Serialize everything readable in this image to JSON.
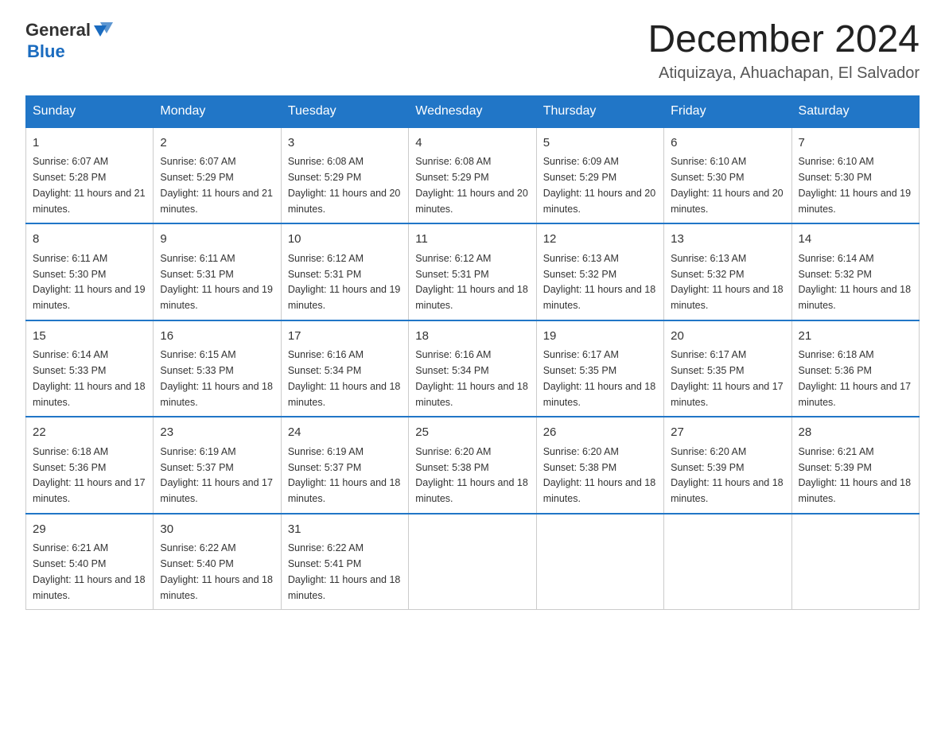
{
  "logo": {
    "text_general": "General",
    "text_blue": "Blue",
    "arrow_color": "#1a6bbf"
  },
  "header": {
    "title": "December 2024",
    "subtitle": "Atiquizaya, Ahuachapan, El Salvador"
  },
  "days_of_week": [
    "Sunday",
    "Monday",
    "Tuesday",
    "Wednesday",
    "Thursday",
    "Friday",
    "Saturday"
  ],
  "weeks": [
    [
      {
        "day": "1",
        "sunrise": "6:07 AM",
        "sunset": "5:28 PM",
        "daylight": "11 hours and 21 minutes."
      },
      {
        "day": "2",
        "sunrise": "6:07 AM",
        "sunset": "5:29 PM",
        "daylight": "11 hours and 21 minutes."
      },
      {
        "day": "3",
        "sunrise": "6:08 AM",
        "sunset": "5:29 PM",
        "daylight": "11 hours and 20 minutes."
      },
      {
        "day": "4",
        "sunrise": "6:08 AM",
        "sunset": "5:29 PM",
        "daylight": "11 hours and 20 minutes."
      },
      {
        "day": "5",
        "sunrise": "6:09 AM",
        "sunset": "5:29 PM",
        "daylight": "11 hours and 20 minutes."
      },
      {
        "day": "6",
        "sunrise": "6:10 AM",
        "sunset": "5:30 PM",
        "daylight": "11 hours and 20 minutes."
      },
      {
        "day": "7",
        "sunrise": "6:10 AM",
        "sunset": "5:30 PM",
        "daylight": "11 hours and 19 minutes."
      }
    ],
    [
      {
        "day": "8",
        "sunrise": "6:11 AM",
        "sunset": "5:30 PM",
        "daylight": "11 hours and 19 minutes."
      },
      {
        "day": "9",
        "sunrise": "6:11 AM",
        "sunset": "5:31 PM",
        "daylight": "11 hours and 19 minutes."
      },
      {
        "day": "10",
        "sunrise": "6:12 AM",
        "sunset": "5:31 PM",
        "daylight": "11 hours and 19 minutes."
      },
      {
        "day": "11",
        "sunrise": "6:12 AM",
        "sunset": "5:31 PM",
        "daylight": "11 hours and 18 minutes."
      },
      {
        "day": "12",
        "sunrise": "6:13 AM",
        "sunset": "5:32 PM",
        "daylight": "11 hours and 18 minutes."
      },
      {
        "day": "13",
        "sunrise": "6:13 AM",
        "sunset": "5:32 PM",
        "daylight": "11 hours and 18 minutes."
      },
      {
        "day": "14",
        "sunrise": "6:14 AM",
        "sunset": "5:32 PM",
        "daylight": "11 hours and 18 minutes."
      }
    ],
    [
      {
        "day": "15",
        "sunrise": "6:14 AM",
        "sunset": "5:33 PM",
        "daylight": "11 hours and 18 minutes."
      },
      {
        "day": "16",
        "sunrise": "6:15 AM",
        "sunset": "5:33 PM",
        "daylight": "11 hours and 18 minutes."
      },
      {
        "day": "17",
        "sunrise": "6:16 AM",
        "sunset": "5:34 PM",
        "daylight": "11 hours and 18 minutes."
      },
      {
        "day": "18",
        "sunrise": "6:16 AM",
        "sunset": "5:34 PM",
        "daylight": "11 hours and 18 minutes."
      },
      {
        "day": "19",
        "sunrise": "6:17 AM",
        "sunset": "5:35 PM",
        "daylight": "11 hours and 18 minutes."
      },
      {
        "day": "20",
        "sunrise": "6:17 AM",
        "sunset": "5:35 PM",
        "daylight": "11 hours and 17 minutes."
      },
      {
        "day": "21",
        "sunrise": "6:18 AM",
        "sunset": "5:36 PM",
        "daylight": "11 hours and 17 minutes."
      }
    ],
    [
      {
        "day": "22",
        "sunrise": "6:18 AM",
        "sunset": "5:36 PM",
        "daylight": "11 hours and 17 minutes."
      },
      {
        "day": "23",
        "sunrise": "6:19 AM",
        "sunset": "5:37 PM",
        "daylight": "11 hours and 17 minutes."
      },
      {
        "day": "24",
        "sunrise": "6:19 AM",
        "sunset": "5:37 PM",
        "daylight": "11 hours and 18 minutes."
      },
      {
        "day": "25",
        "sunrise": "6:20 AM",
        "sunset": "5:38 PM",
        "daylight": "11 hours and 18 minutes."
      },
      {
        "day": "26",
        "sunrise": "6:20 AM",
        "sunset": "5:38 PM",
        "daylight": "11 hours and 18 minutes."
      },
      {
        "day": "27",
        "sunrise": "6:20 AM",
        "sunset": "5:39 PM",
        "daylight": "11 hours and 18 minutes."
      },
      {
        "day": "28",
        "sunrise": "6:21 AM",
        "sunset": "5:39 PM",
        "daylight": "11 hours and 18 minutes."
      }
    ],
    [
      {
        "day": "29",
        "sunrise": "6:21 AM",
        "sunset": "5:40 PM",
        "daylight": "11 hours and 18 minutes."
      },
      {
        "day": "30",
        "sunrise": "6:22 AM",
        "sunset": "5:40 PM",
        "daylight": "11 hours and 18 minutes."
      },
      {
        "day": "31",
        "sunrise": "6:22 AM",
        "sunset": "5:41 PM",
        "daylight": "11 hours and 18 minutes."
      },
      null,
      null,
      null,
      null
    ]
  ],
  "labels": {
    "sunrise": "Sunrise:",
    "sunset": "Sunset:",
    "daylight": "Daylight:"
  }
}
